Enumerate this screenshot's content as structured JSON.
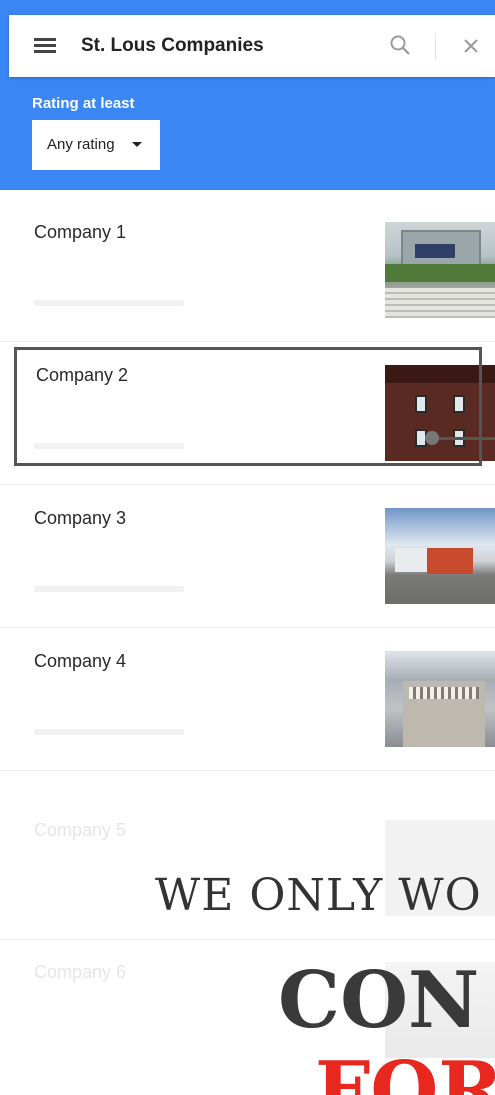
{
  "header": {
    "title": "St. Lous Companies",
    "filter_label": "Rating at least",
    "filter_value": "Any rating",
    "background_color": "#3b86f5"
  },
  "icons": {
    "menu": "menu-icon",
    "search": "search-icon",
    "close": "close-icon",
    "dropdown": "caret-down-icon"
  },
  "companies": [
    {
      "name": "Company 1"
    },
    {
      "name": "Company 2"
    },
    {
      "name": "Company 3"
    },
    {
      "name": "Company 4"
    },
    {
      "name": "Company 5"
    },
    {
      "name": "Company 6"
    }
  ],
  "overlay": {
    "line1": "WE ONLY WO",
    "line2": "CON",
    "line3": "FOR",
    "accent_color": "#e8271f"
  }
}
